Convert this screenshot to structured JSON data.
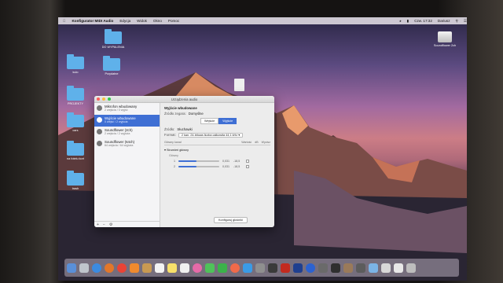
{
  "menubar": {
    "app_name": "Konfigurator MIDI Audio",
    "menus": [
      "Edycja",
      "Widok",
      "Okno",
      "Pomoc"
    ],
    "clock": "Czw. 17:32",
    "user": "Dariusz"
  },
  "desktop": {
    "icons": [
      {
        "label": "DO WYPALENIA"
      },
      {
        "label": "kulo"
      },
      {
        "label": "Przydatne"
      },
      {
        "label": "PROJEKTY"
      },
      {
        "label": "cars"
      },
      {
        "label": "na fotelu kort"
      },
      {
        "label": "trash"
      }
    ],
    "drive_label": "Soundflower 2ch"
  },
  "window": {
    "title": "Urządzenia audio",
    "devices": [
      {
        "name": "Mikrofon wbudowany",
        "sub": "2 wejścia / 0 wyjść"
      },
      {
        "name": "Wyjście wbudowane",
        "sub": "0 wejść / 2 wyjścia"
      },
      {
        "name": "Soundflower (2ch)",
        "sub": "2 wejścia / 2 wyjścia"
      },
      {
        "name": "Soundflower (64ch)",
        "sub": "64 wejścia / 64 wyjścia"
      }
    ],
    "selected_title": "Wyjście wbudowane",
    "clock_source_label": "Źródło zegara:",
    "clock_source_value": "Domyślne",
    "segments": [
      "Wejście",
      "Wyjście"
    ],
    "source_label": "Źródło:",
    "source_value": "Słuchawki",
    "format_label": "Format:",
    "format_value": "2 kan. 24-bitowa liczba całkowita 44,1 kHz",
    "tab_main": "Główny kanał",
    "tab_right": [
      "Wartość",
      "dB",
      "Wycisz"
    ],
    "master_stream": "Strumień główny",
    "channels_label": "Główny",
    "channels": [
      {
        "num": "1",
        "value": "0,031",
        "db": "-18,5",
        "level": 0.45
      },
      {
        "num": "2",
        "value": "0,031",
        "db": "-18,5",
        "level": 0.45
      }
    ],
    "configure_button": "Konfiguruj głośniki"
  }
}
